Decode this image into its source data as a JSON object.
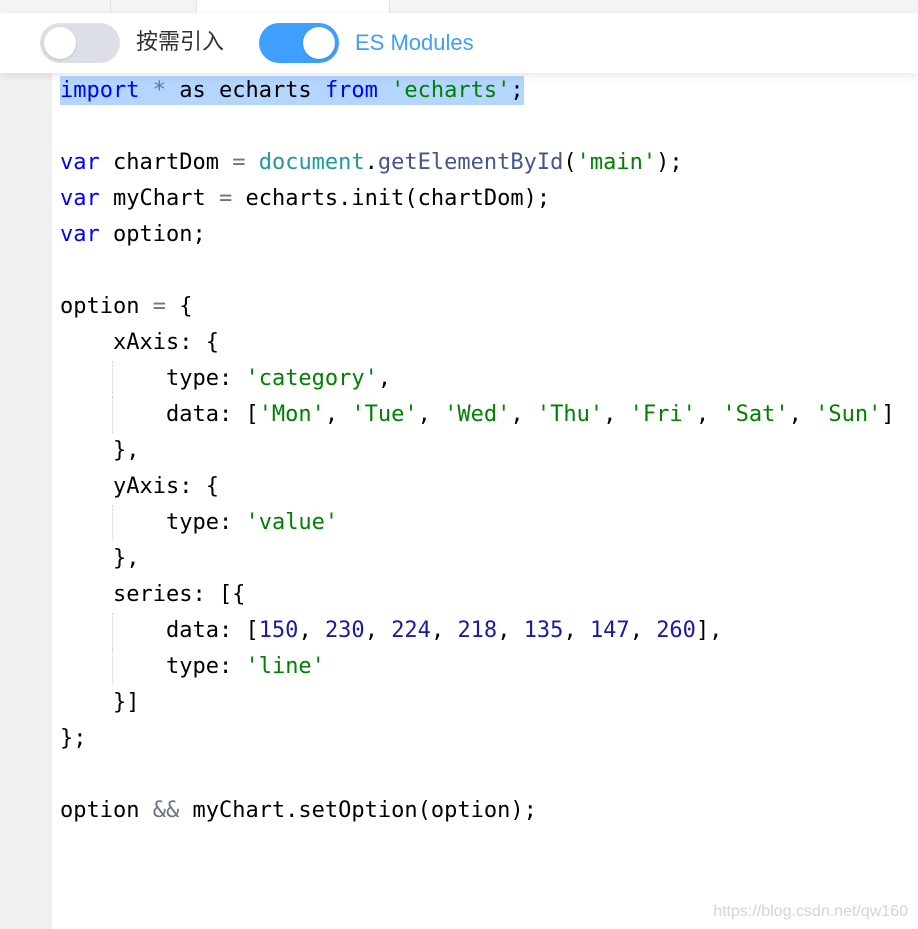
{
  "toolbar": {
    "toggle_on_demand": {
      "label": "按需引入",
      "state": "off"
    },
    "toggle_es_modules": {
      "label": "ES Modules",
      "state": "on"
    }
  },
  "code": {
    "l1": {
      "kw1": "import",
      "op1": "*",
      "t1": " as echarts ",
      "kw2": "from",
      "str1": "'echarts'",
      "t2": ";"
    },
    "l3": {
      "kw": "var",
      "t1": " chartDom ",
      "op": "=",
      "gl": "document",
      "t2": ".",
      "fn": "getElementById",
      "t3": "(",
      "str": "'main'",
      "t4": ");"
    },
    "l4": {
      "kw": "var",
      "t1": " myChart ",
      "op": "=",
      "t2": " echarts.init(chartDom);"
    },
    "l5": {
      "kw": "var",
      "t1": " option;"
    },
    "l7": {
      "t1": "option ",
      "op": "=",
      "t2": " {"
    },
    "l8": {
      "t1": "    xAxis: {"
    },
    "l9": {
      "t1": "type: ",
      "str": "'category'",
      "t2": ","
    },
    "l10": {
      "t1": "data: [",
      "days": [
        "'Mon'",
        "'Tue'",
        "'Wed'",
        "'Thu'",
        "'Fri'",
        "'Sat'",
        "'Sun'"
      ],
      "sep": ", ",
      "t2": "]"
    },
    "l11": {
      "t1": "    },"
    },
    "l12": {
      "t1": "    yAxis: {"
    },
    "l13": {
      "t1": "type: ",
      "str": "'value'"
    },
    "l14": {
      "t1": "    },"
    },
    "l15": {
      "t1": "    series: [{"
    },
    "l16": {
      "t1": "data: [",
      "nums": [
        "150",
        "230",
        "224",
        "218",
        "135",
        "147",
        "260"
      ],
      "sep": ", ",
      "t2": "],"
    },
    "l17": {
      "t1": "type: ",
      "str": "'line'"
    },
    "l18": {
      "t1": "    }]"
    },
    "l19": {
      "t1": "};"
    },
    "l21": {
      "t1": "option ",
      "op": "&&",
      "t2": " myChart.setOption(option);"
    }
  },
  "watermark": "https://blog.csdn.net/qw160",
  "colors": {
    "accent": "#409eff",
    "keyword": "#0000ff",
    "string": "#008000",
    "number": "#1a1aa6",
    "selection": "#b4d5fe"
  }
}
